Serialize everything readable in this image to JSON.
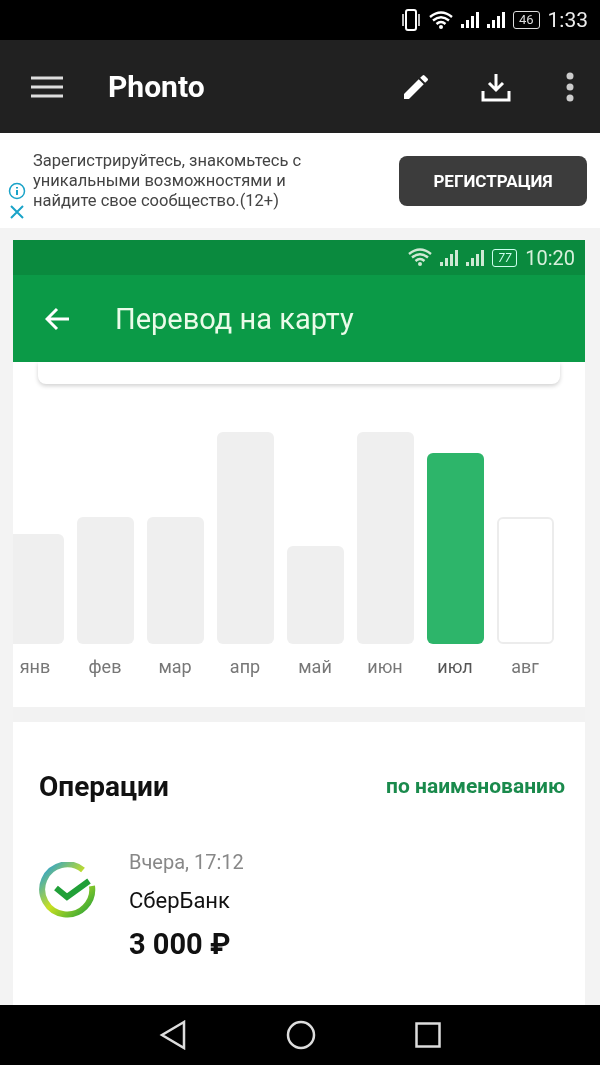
{
  "status_bar": {
    "time": "1:33",
    "battery": "46"
  },
  "app_bar": {
    "title": "Phonto"
  },
  "ad": {
    "text": "Зарегистрируйтесь, знакомьтесь с уникальными возможностями и найдите свое сообщество.(12+)",
    "button": "РЕГИСТРАЦИЯ"
  },
  "screenshot": {
    "status_bar": {
      "time": "10:20",
      "battery": "77"
    },
    "title": "Перевод на карту",
    "months": [
      {
        "label": "янв",
        "kind": "past",
        "selected": false
      },
      {
        "label": "фев",
        "kind": "past",
        "selected": false
      },
      {
        "label": "мар",
        "kind": "past",
        "selected": false
      },
      {
        "label": "апр",
        "kind": "past",
        "selected": false
      },
      {
        "label": "май",
        "kind": "past",
        "selected": false
      },
      {
        "label": "июн",
        "kind": "past",
        "selected": false
      },
      {
        "label": "июл",
        "kind": "past",
        "selected": true
      },
      {
        "label": "авг",
        "kind": "future",
        "selected": false
      }
    ],
    "operations": {
      "title": "Операции",
      "sort": "по наименованию",
      "items": [
        {
          "time": "Вчера, 17:12",
          "name": "СберБанк",
          "amount": "3 000 ₽"
        }
      ]
    }
  }
}
